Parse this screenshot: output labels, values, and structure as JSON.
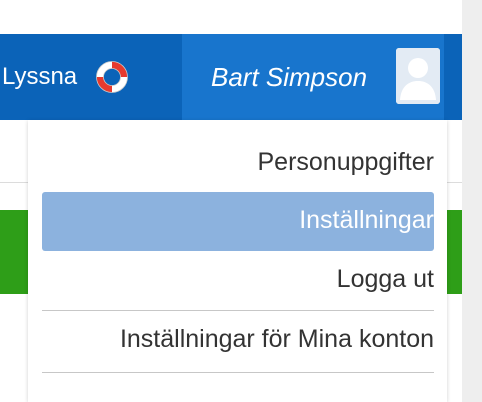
{
  "nav": {
    "help_label": "Lyssna",
    "user_name": "Bart Simpson"
  },
  "menu": {
    "items": [
      {
        "label": "Personuppgifter"
      },
      {
        "label": "Inställningar",
        "active": true
      },
      {
        "label": "Logga ut"
      },
      {
        "label": "Inställningar för Mina konton"
      }
    ]
  },
  "colors": {
    "nav_bar": "#0b63b8",
    "nav_user_bg": "#1875cd",
    "active_item_bg": "#8cb2de",
    "green_accent": "#2e9e18"
  },
  "icons": {
    "help": "lifebuoy-icon",
    "user": "user-avatar-icon"
  }
}
